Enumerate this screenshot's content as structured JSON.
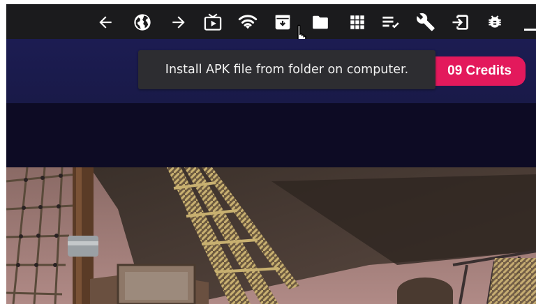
{
  "toolbar": {
    "icons": [
      {
        "name": "back-arrow-icon",
        "glyph": "arrow-left"
      },
      {
        "name": "globe-icon",
        "glyph": "globe"
      },
      {
        "name": "forward-arrow-icon",
        "glyph": "arrow-right"
      },
      {
        "name": "tv-icon",
        "glyph": "tv-play"
      },
      {
        "name": "wifi-icon",
        "glyph": "wifi"
      },
      {
        "name": "install-apk-icon",
        "glyph": "package-down"
      },
      {
        "name": "folder-icon",
        "glyph": "folder"
      },
      {
        "name": "apps-grid-icon",
        "glyph": "grid"
      },
      {
        "name": "playlist-check-icon",
        "glyph": "list-check"
      },
      {
        "name": "wrench-icon",
        "glyph": "wrench"
      },
      {
        "name": "input-icon",
        "glyph": "login-box"
      },
      {
        "name": "bug-icon",
        "glyph": "bug"
      },
      {
        "name": "minimize-icon",
        "glyph": "minus"
      }
    ],
    "icon_color": "#ffffff"
  },
  "tooltip": {
    "text": "Install APK file from folder on computer."
  },
  "credits": {
    "label": "09 Credits",
    "color": "#e3195c"
  },
  "colors": {
    "toolbar_bg": "#1b1b1d",
    "header_bg": "#1c1c52",
    "page_bg": "#0d0b24",
    "tooltip_bg": "#2d2d31"
  }
}
